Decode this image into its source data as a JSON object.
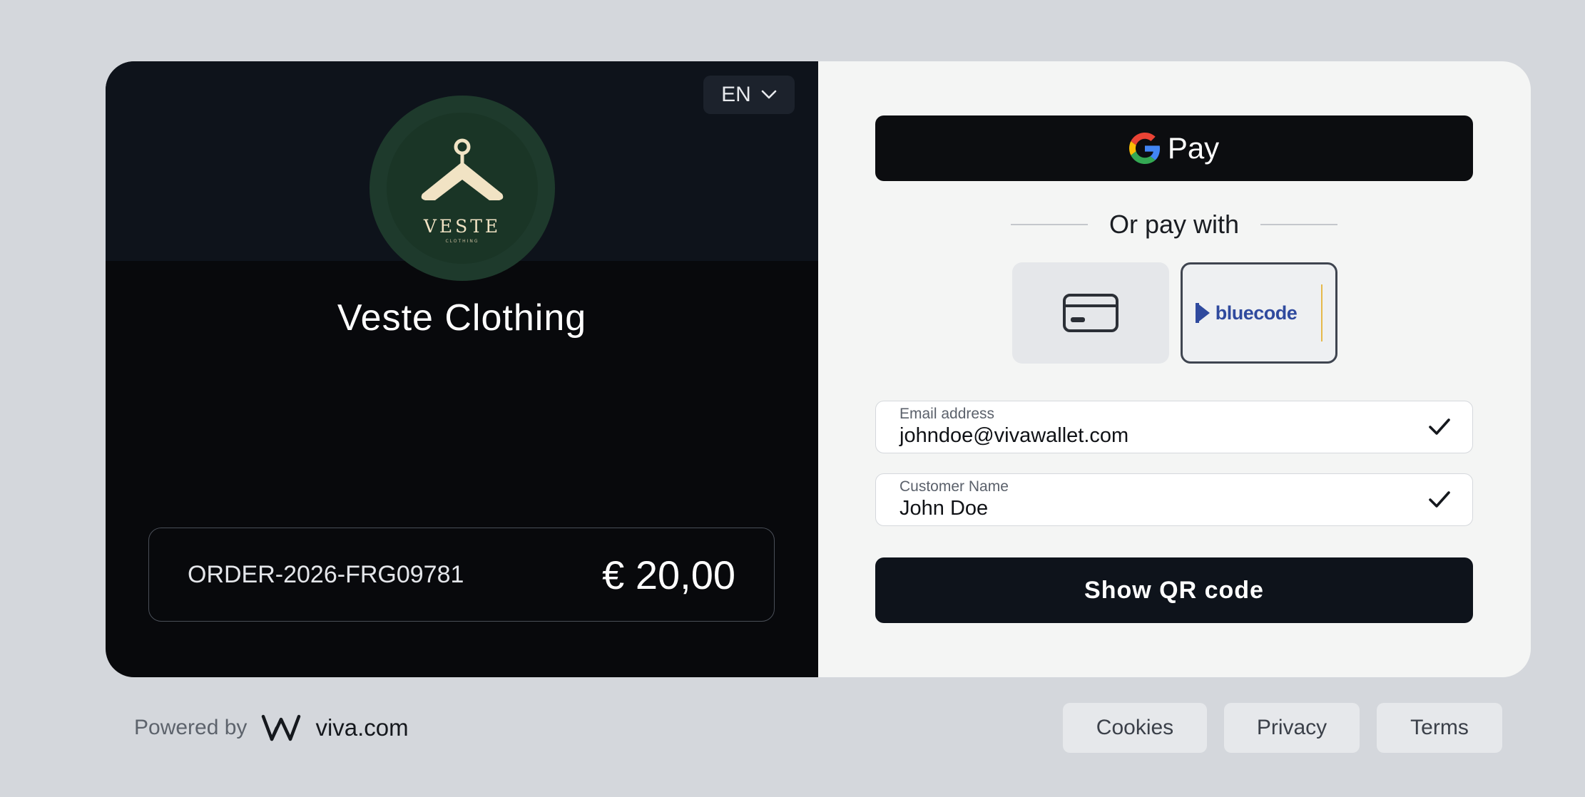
{
  "header": {
    "language": "EN"
  },
  "merchant": {
    "logo_brand": "VESTE",
    "logo_sub": "CLOTHING",
    "name": "Veste Clothing"
  },
  "order": {
    "id": "ORDER-2026-FRG09781",
    "amount": "€ 20,00"
  },
  "payment": {
    "gpay_label": "Pay",
    "divider_text": "Or pay with",
    "methods": [
      {
        "name": "card",
        "icon": "credit-card-icon",
        "selected": false
      },
      {
        "name": "bluecode",
        "label": "bluecode",
        "selected": true
      }
    ]
  },
  "form": {
    "email": {
      "label": "Email address",
      "value": "johndoe@vivawallet.com"
    },
    "customer_name": {
      "label": "Customer Name",
      "value": "John Doe"
    }
  },
  "actions": {
    "show_qr_label": "Show QR code"
  },
  "footer": {
    "powered_by": "Powered by",
    "brand": "viva.com",
    "links": {
      "cookies": "Cookies",
      "privacy": "Privacy",
      "terms": "Terms"
    }
  },
  "colors": {
    "left_panel": "#08090c",
    "left_header": "#0e131b",
    "logo_circle": "#1e3a2c",
    "logo_accent": "#f1e3c4",
    "right_panel": "#f4f5f4",
    "primary_button": "#0e131b",
    "bluecode_blue": "#2f4a9e"
  }
}
